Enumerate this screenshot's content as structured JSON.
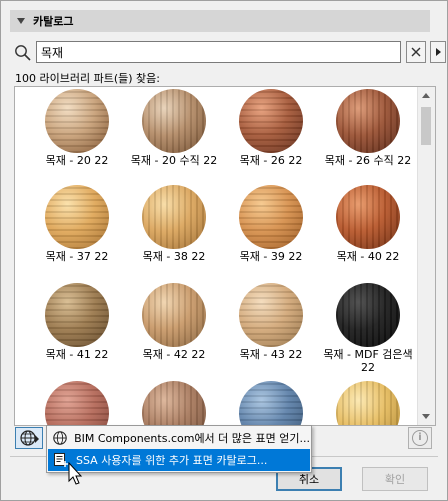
{
  "catalog": {
    "title": "카탈로그",
    "search": {
      "value": "목재",
      "placeholder": ""
    },
    "result_count": "100 라이브러리 파트(들) 찾음:"
  },
  "materials": [
    {
      "label": "목재 - 20 22",
      "base": "#c9a27a",
      "dark": "#7a4e2a",
      "light": "#f2dcc0"
    },
    {
      "label": "목재 - 20 수직 22",
      "base": "#b48c68",
      "dark": "#6e4a2c",
      "light": "#e8d2b8"
    },
    {
      "label": "목재 - 26 22",
      "base": "#a65a3a",
      "dark": "#5e2a18",
      "light": "#e8a07c"
    },
    {
      "label": "목재 - 26 수직 22",
      "base": "#9b5335",
      "dark": "#542414",
      "light": "#dc9874"
    },
    {
      "label": "목재 - 37 22",
      "base": "#e0a85a",
      "dark": "#a06a2a",
      "light": "#fbe0a8"
    },
    {
      "label": "목재 - 38 22",
      "base": "#dba65e",
      "dark": "#9c6a2e",
      "light": "#f8dca4"
    },
    {
      "label": "목재 - 39 22",
      "base": "#d7914e",
      "dark": "#98561e",
      "light": "#f6c88c"
    },
    {
      "label": "목재 - 40 22",
      "base": "#b8582c",
      "dark": "#6a2a10",
      "light": "#e89868"
    },
    {
      "label": "목재 - 41 22",
      "base": "#9c7a4e",
      "dark": "#5e4426",
      "light": "#d8bc90"
    },
    {
      "label": "목재 - 42 22",
      "base": "#c99a6a",
      "dark": "#84603a",
      "light": "#f0d4ae"
    },
    {
      "label": "목재 - 43 22",
      "base": "#d3a97a",
      "dark": "#927046",
      "light": "#f4dcbc"
    },
    {
      "label": "목재 - MDF 검은색 22",
      "base": "#1e1e1e",
      "dark": "#050505",
      "light": "#4a4a4a"
    },
    {
      "label": "",
      "base": "#b56a5a",
      "dark": "#7a3e32",
      "light": "#e0a090"
    },
    {
      "label": "",
      "base": "#a87a5e",
      "dark": "#6e4a34",
      "light": "#dcb498"
    },
    {
      "label": "",
      "base": "#5f82aa",
      "dark": "#34506e",
      "light": "#a8c4e0"
    },
    {
      "label": "",
      "base": "#e6bc60",
      "dark": "#a8802a",
      "light": "#fce8b0"
    }
  ],
  "popup_menu": {
    "items": [
      {
        "label": "BIM Components.com에서 더 많은 표면 얻기...",
        "icon": "globe-icon"
      },
      {
        "label": "SSA 사용자를 위한 추가 표면 카탈로그...",
        "icon": "catalog-add-icon"
      }
    ]
  },
  "footer": {
    "cancel_label": "취소",
    "ok_label": "확인",
    "info_label": "i"
  }
}
